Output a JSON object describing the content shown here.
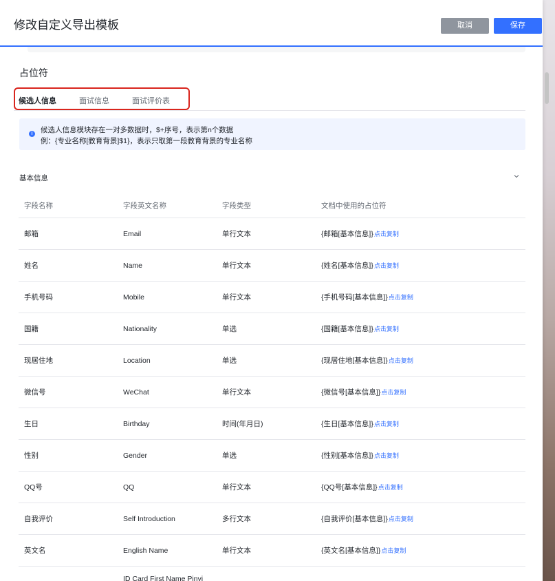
{
  "modal": {
    "title": "修改自定义导出模板",
    "cancel_label": "取消",
    "save_label": "保存"
  },
  "section_title": "占位符",
  "tabs": [
    {
      "label": "候选人信息",
      "active": true
    },
    {
      "label": "面试信息",
      "active": false
    },
    {
      "label": "面试评价表",
      "active": false
    }
  ],
  "notice": {
    "icon": "info-icon",
    "line1": "候选人信息模块存在一对多数据时，$+序号，表示第n个数据",
    "line2": "例：{专业名称[教育背景]$1}，表示只取第一段教育背景的专业名称"
  },
  "group": {
    "title": "基本信息",
    "icon": "chevron-down-icon"
  },
  "table": {
    "headers": [
      "字段名称",
      "字段英文名称",
      "字段类型",
      "文档中使用的占位符"
    ],
    "copy_label": "点击复制",
    "rows": [
      {
        "name": "邮箱",
        "en": "Email",
        "type": "单行文本",
        "placeholder": "{邮箱[基本信息]}"
      },
      {
        "name": "姓名",
        "en": "Name",
        "type": "单行文本",
        "placeholder": "{姓名[基本信息]}"
      },
      {
        "name": "手机号码",
        "en": "Mobile",
        "type": "单行文本",
        "placeholder": "{手机号码[基本信息]}"
      },
      {
        "name": "国籍",
        "en": "Nationality",
        "type": "单选",
        "placeholder": "{国籍[基本信息]}"
      },
      {
        "name": "现居住地",
        "en": "Location",
        "type": "单选",
        "placeholder": "{现居住地[基本信息]}"
      },
      {
        "name": "微信号",
        "en": "WeChat",
        "type": "单行文本",
        "placeholder": "{微信号[基本信息]}"
      },
      {
        "name": "生日",
        "en": "Birthday",
        "type": "时间(年月日)",
        "placeholder": "{生日[基本信息]}"
      },
      {
        "name": "性别",
        "en": "Gender",
        "type": "单选",
        "placeholder": "{性别[基本信息]}"
      },
      {
        "name": "QQ号",
        "en": "QQ",
        "type": "单行文本",
        "placeholder": "{QQ号[基本信息]}"
      },
      {
        "name": "自我评价",
        "en": "Self Introduction",
        "type": "多行文本",
        "placeholder": "{自我评价[基本信息]}"
      },
      {
        "name": "英文名",
        "en": "English Name",
        "type": "单行文本",
        "placeholder": "{英文名[基本信息]}"
      }
    ],
    "partial_row": {
      "en": "ID Card First Name Pinyi"
    }
  },
  "colors": {
    "accent": "#3370ff",
    "highlight_border": "#d9251d",
    "cancel_bg": "#8f959e"
  }
}
